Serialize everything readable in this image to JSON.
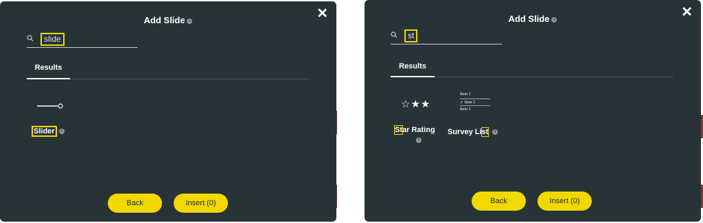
{
  "dialogs": [
    {
      "title": "Add Slide",
      "search_value": "slide",
      "tab": "Results",
      "results": [
        {
          "label": "Slider",
          "icon": "slider-icon"
        }
      ],
      "back_label": "Back",
      "insert_label": "Insert (0)"
    },
    {
      "title": "Add Slide",
      "search_value": "st",
      "tab": "Results",
      "results": [
        {
          "label_pre": "",
          "label_hl": "St",
          "label_post": "ar Rating",
          "icon": "star-rating-icon",
          "stars": "☆★★"
        },
        {
          "label_pre": "Survey Li",
          "label_hl": "st",
          "label_post": "",
          "icon": "survey-list-icon",
          "items": [
            "Item 1",
            "Item 2",
            "Item 3"
          ]
        }
      ],
      "back_label": "Back",
      "insert_label": "Insert (0)"
    }
  ],
  "colors": {
    "panel": "#283338",
    "accent": "#f1d900",
    "text": "#ffffff"
  }
}
